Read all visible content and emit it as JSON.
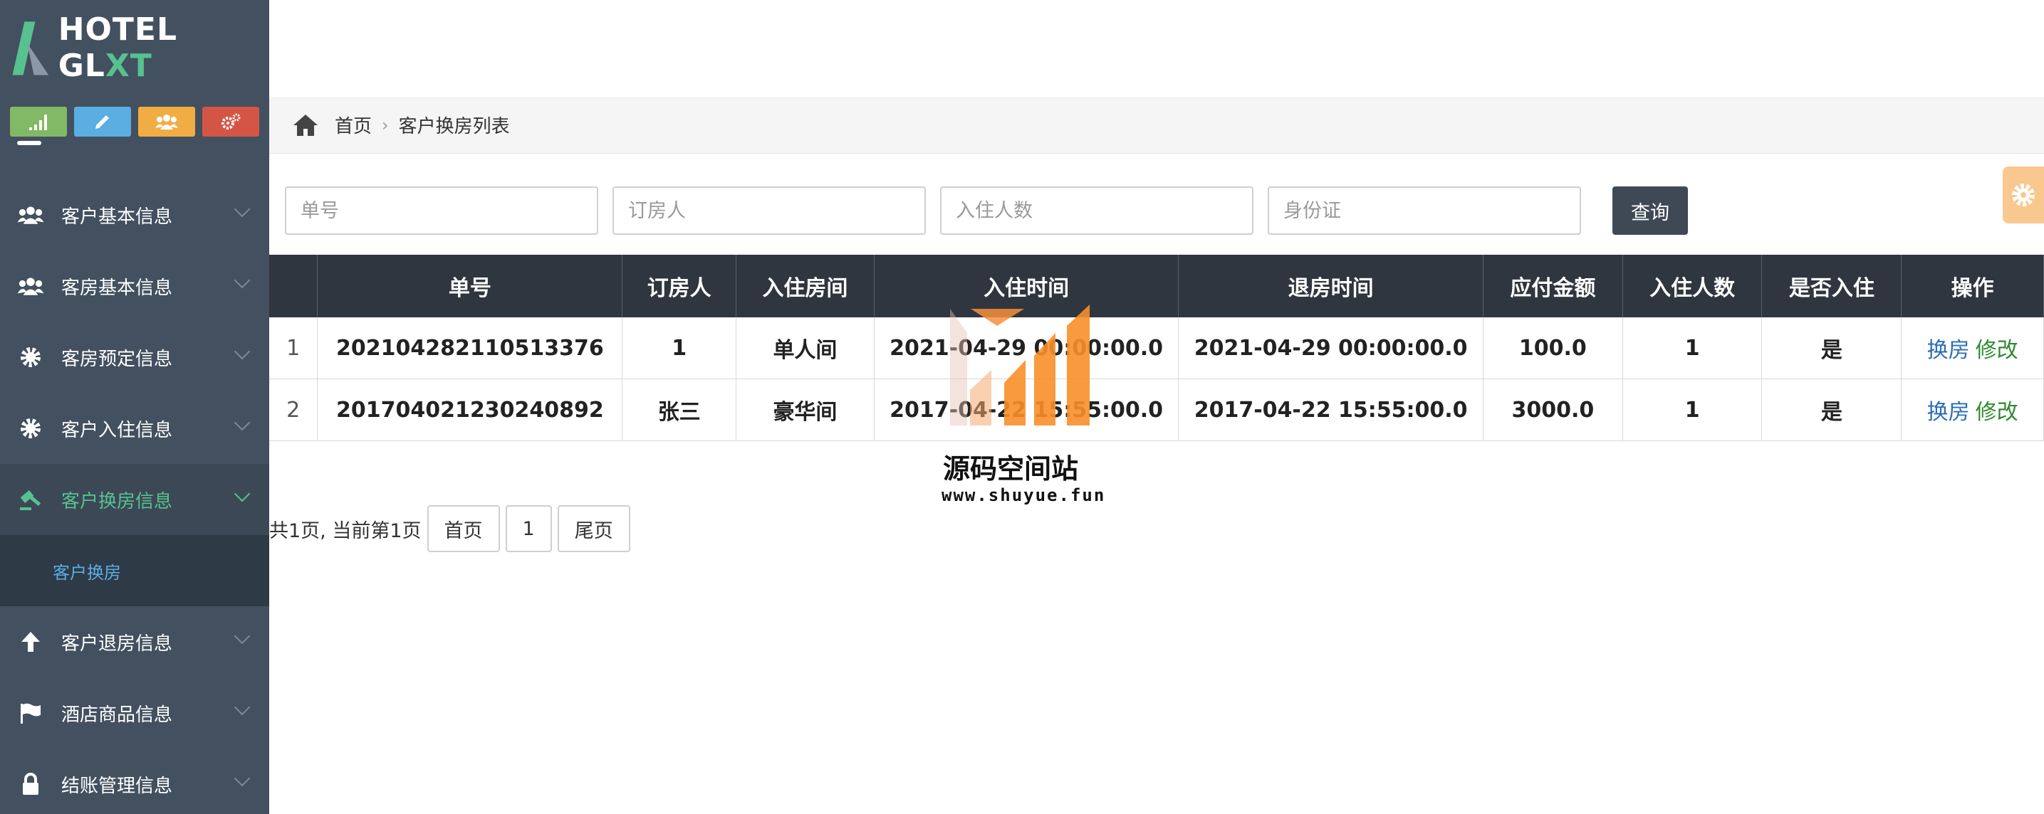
{
  "app": {
    "logo_text_main": "HOTEL GL",
    "logo_text_accent": "XT",
    "accent_color": "#57c28f"
  },
  "shortcuts": [
    {
      "icon": "signal-icon",
      "color": "#82b964"
    },
    {
      "icon": "pencil-icon",
      "color": "#5aaee2"
    },
    {
      "icon": "users-icon",
      "color": "#f2ac44"
    },
    {
      "icon": "cogs-icon",
      "color": "#d45545"
    }
  ],
  "sidebar": {
    "items": [
      {
        "label": "客户基本信息",
        "icon": "users-icon"
      },
      {
        "label": "客房基本信息",
        "icon": "users-icon"
      },
      {
        "label": "客房预定信息",
        "icon": "gear-icon"
      },
      {
        "label": "客户入住信息",
        "icon": "gear-icon"
      },
      {
        "label": "客户换房信息",
        "icon": "gavel-icon",
        "active": true
      },
      {
        "label": "客户退房信息",
        "icon": "arrow-up-icon"
      },
      {
        "label": "酒店商品信息",
        "icon": "flag-icon"
      },
      {
        "label": "结账管理信息",
        "icon": "lock-icon"
      }
    ],
    "submenu_active": "客户换房"
  },
  "breadcrumb": {
    "home": "首页",
    "current": "客户换房列表"
  },
  "search": {
    "order_no_placeholder": "单号",
    "booker_placeholder": "订房人",
    "guests_placeholder": "入住人数",
    "id_card_placeholder": "身份证",
    "query_label": "查询"
  },
  "table": {
    "headers": [
      "",
      "单号",
      "订房人",
      "入住房间",
      "入住时间",
      "退房时间",
      "应付金额",
      "入住人数",
      "是否入住",
      "操作"
    ],
    "rows": [
      {
        "idx": "1",
        "order_no": "202104282110513376",
        "booker": "1",
        "room": "单人间",
        "checkin": "2021-04-29 00:00:00.0",
        "checkout": "2021-04-29 00:00:00.0",
        "amount": "100.0",
        "guests": "1",
        "checked_in": "是",
        "op_change": "换房",
        "op_edit": "修改"
      },
      {
        "idx": "2",
        "order_no": "201704021230240892",
        "booker": "张三",
        "room": "豪华间",
        "checkin": "2017-04-22 15:55:00.0",
        "checkout": "2017-04-22 15:55:00.0",
        "amount": "3000.0",
        "guests": "1",
        "checked_in": "是",
        "op_change": "换房",
        "op_edit": "修改"
      }
    ]
  },
  "pager": {
    "summary": "共1页, 当前第1页",
    "first": "首页",
    "page": "1",
    "last": "尾页"
  },
  "watermark": {
    "title": "源码空间站",
    "url": "www.shuyue.fun"
  }
}
